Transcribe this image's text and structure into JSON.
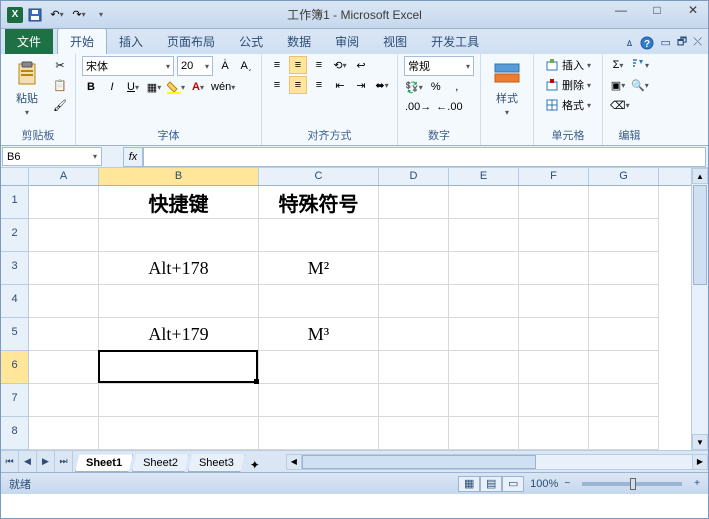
{
  "title": "工作簿1 - Microsoft Excel",
  "tabs": {
    "file": "文件",
    "home": "开始",
    "insert": "插入",
    "layout": "页面布局",
    "formulas": "公式",
    "data": "数据",
    "review": "审阅",
    "view": "视图",
    "dev": "开发工具"
  },
  "groups": {
    "clipboard": {
      "label": "剪贴板",
      "paste": "粘贴"
    },
    "font": {
      "label": "字体",
      "name": "宋体",
      "size": "20"
    },
    "align": {
      "label": "对齐方式"
    },
    "number": {
      "label": "数字",
      "format": "常规"
    },
    "styles": {
      "label": "样式",
      "btn": "样式"
    },
    "cells": {
      "label": "单元格",
      "insert": "插入",
      "delete": "删除",
      "format": "格式"
    },
    "editing": {
      "label": "编辑"
    }
  },
  "namebox": "B6",
  "fx": "fx",
  "colw": {
    "A": 70,
    "B": 160,
    "C": 120,
    "D": 70,
    "E": 70,
    "F": 70,
    "G": 70
  },
  "cols": [
    "A",
    "B",
    "C",
    "D",
    "E",
    "F",
    "G"
  ],
  "rows": [
    "1",
    "2",
    "3",
    "4",
    "5",
    "6",
    "7",
    "8"
  ],
  "cells": {
    "B1": "快捷键",
    "C1": "特殊符号",
    "B3": "Alt+178",
    "C3": "M²",
    "B5": "Alt+179",
    "C5": "M³"
  },
  "selection": {
    "col": "B",
    "row": 6
  },
  "sheets": {
    "active": "Sheet1",
    "s2": "Sheet2",
    "s3": "Sheet3"
  },
  "status": {
    "ready": "就绪",
    "zoom": "100%"
  }
}
